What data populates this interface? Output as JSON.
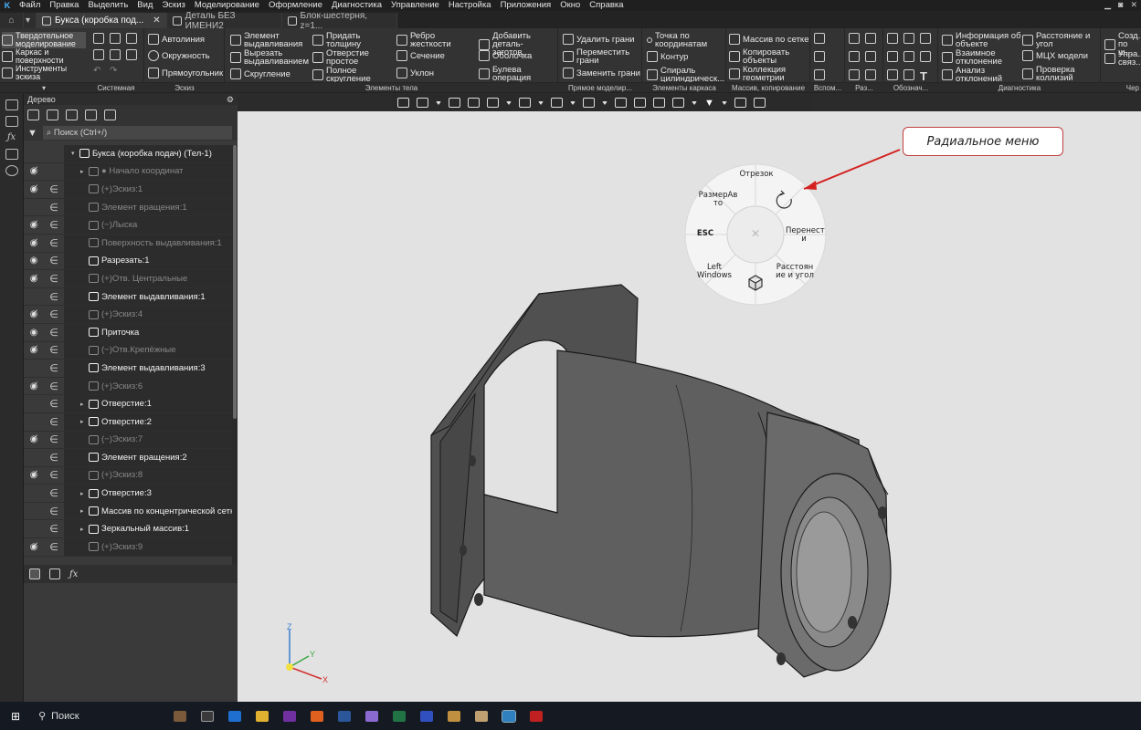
{
  "menu": [
    "Файл",
    "Правка",
    "Выделить",
    "Вид",
    "Эскиз",
    "Моделирование",
    "Оформление",
    "Диагностика",
    "Управление",
    "Настройка",
    "Приложения",
    "Окно",
    "Справка"
  ],
  "tabs": [
    {
      "label": "Букса (коробка под...",
      "active": true
    },
    {
      "label": "Деталь БЕЗ ИМЕНИ2",
      "active": false
    },
    {
      "label": "Блок-шестерня, z=1...",
      "active": false
    }
  ],
  "modes": [
    "Твердотельное моделирование",
    "Каркас и поверхности",
    "Инструменты эскиза"
  ],
  "ribbon": {
    "sys": [
      "Системная"
    ],
    "sketch_buttons": [
      "Автолиния",
      "Окружность",
      "Прямоугольник"
    ],
    "body_buttons": [
      "Элемент выдавливания",
      "Вырезать выдавливанием",
      "Скругление",
      "Придать толщину",
      "Отверстие простое",
      "Полное скругление",
      "Ребро жесткости",
      "Сечение",
      "Уклон",
      "Добавить деталь-заготов...",
      "Оболочка",
      "Булева операция"
    ],
    "direct_buttons": [
      "Удалить грани",
      "Переместить грани",
      "Заменить грани"
    ],
    "wire_buttons": [
      "Точка по координатам",
      "Контур",
      "Спираль цилиндрическ..."
    ],
    "array_buttons": [
      "Массив по сетке",
      "Копировать объекты",
      "Коллекция геометрии"
    ],
    "diag_buttons": [
      "Информация об объекте",
      "Взаимное отклонение",
      "Анализ отклонений",
      "Расстояние и угол",
      "МЦХ модели",
      "Проверка коллизий"
    ],
    "edge_buttons": [
      "Созд... по ш...",
      "Упра... связ..."
    ],
    "group_labels": [
      "Системная",
      "Эскиз",
      "Элементы тела",
      "Прямое моделир...",
      "Элементы каркаса",
      "Массив, копирование",
      "Вспом...",
      "Раз...",
      "Обознач...",
      "Диагностика",
      "Чер"
    ]
  },
  "tree": {
    "title": "Дерево",
    "search_placeholder": "Поиск (Ctrl+/)",
    "rows": [
      {
        "eye": "",
        "vis": "",
        "name": "Букса (коробка подач) (Тел-1)",
        "style": "bright",
        "arrow": "▾",
        "indent": 0
      },
      {
        "eye": "◉̸",
        "vis": "",
        "name": "● Начало координат",
        "style": "dim",
        "arrow": "▸",
        "indent": 1
      },
      {
        "eye": "◉̸",
        "vis": "∈",
        "name": "(+)Эскиз:1",
        "style": "dim",
        "arrow": "",
        "indent": 1
      },
      {
        "eye": "",
        "vis": "∈",
        "name": "Элемент вращения:1",
        "style": "dim",
        "arrow": "",
        "indent": 1
      },
      {
        "eye": "◉̸",
        "vis": "∈",
        "name": "(−)Лыска",
        "style": "dim",
        "arrow": "",
        "indent": 1
      },
      {
        "eye": "◉̸",
        "vis": "∈",
        "name": "Поверхность выдавливания:1",
        "style": "dim",
        "arrow": "",
        "indent": 1
      },
      {
        "eye": "◉",
        "vis": "∈",
        "name": "Разрезать:1",
        "style": "bright",
        "arrow": "",
        "indent": 1
      },
      {
        "eye": "◉̸",
        "vis": "∈",
        "name": "(+)Отв. Центральные",
        "style": "dim",
        "arrow": "",
        "indent": 1
      },
      {
        "eye": "",
        "vis": "∈",
        "name": "Элемент выдавливания:1",
        "style": "bright",
        "arrow": "",
        "indent": 1
      },
      {
        "eye": "◉̸",
        "vis": "∈",
        "name": "(+)Эскиз:4",
        "style": "dim",
        "arrow": "",
        "indent": 1
      },
      {
        "eye": "◉",
        "vis": "∈",
        "name": "Приточка",
        "style": "bright",
        "arrow": "",
        "indent": 1
      },
      {
        "eye": "◉̸",
        "vis": "∈",
        "name": "(−)Отв.Крепёжные",
        "style": "dim",
        "arrow": "",
        "indent": 1
      },
      {
        "eye": "",
        "vis": "∈",
        "name": "Элемент выдавливания:3",
        "style": "bright",
        "arrow": "",
        "indent": 1
      },
      {
        "eye": "◉̸",
        "vis": "∈",
        "name": "(+)Эскиз:6",
        "style": "dim",
        "arrow": "",
        "indent": 1
      },
      {
        "eye": "",
        "vis": "∈",
        "name": "Отверстие:1",
        "style": "bright",
        "arrow": "▸",
        "indent": 1
      },
      {
        "eye": "",
        "vis": "∈",
        "name": "Отверстие:2",
        "style": "bright",
        "arrow": "▸",
        "indent": 1
      },
      {
        "eye": "◉̸",
        "vis": "∈",
        "name": "(−)Эскиз:7",
        "style": "dim",
        "arrow": "",
        "indent": 1
      },
      {
        "eye": "",
        "vis": "∈",
        "name": "Элемент вращения:2",
        "style": "bright",
        "arrow": "",
        "indent": 1
      },
      {
        "eye": "◉̸",
        "vis": "∈",
        "name": "(+)Эскиз:8",
        "style": "dim",
        "arrow": "",
        "indent": 1
      },
      {
        "eye": "",
        "vis": "∈",
        "name": "Отверстие:3",
        "style": "bright",
        "arrow": "▸",
        "indent": 1
      },
      {
        "eye": "",
        "vis": "∈",
        "name": "Массив по концентрической сетке:",
        "style": "bright",
        "arrow": "▸",
        "indent": 1
      },
      {
        "eye": "",
        "vis": "∈",
        "name": "Зеркальный массив:1",
        "style": "bright",
        "arrow": "▸",
        "indent": 1
      },
      {
        "eye": "◉̸",
        "vis": "∈",
        "name": "(+)Эскиз:9",
        "style": "dim",
        "arrow": "",
        "indent": 1
      }
    ]
  },
  "radial_menu": {
    "center": "✕",
    "items": [
      "Отрезок",
      "Перенест и",
      "Расстоян ие и угол",
      "Left Windows",
      "ESC",
      "РазмерАв то"
    ]
  },
  "callout": "Радиальное меню",
  "axes": {
    "x": "X",
    "y": "Y",
    "z": "Z"
  },
  "taskbar": {
    "search": "Поиск"
  },
  "colors": {
    "viewport": "#e2e2e2",
    "model": "#5a5a5a",
    "callout_arrow": "#d42020"
  }
}
